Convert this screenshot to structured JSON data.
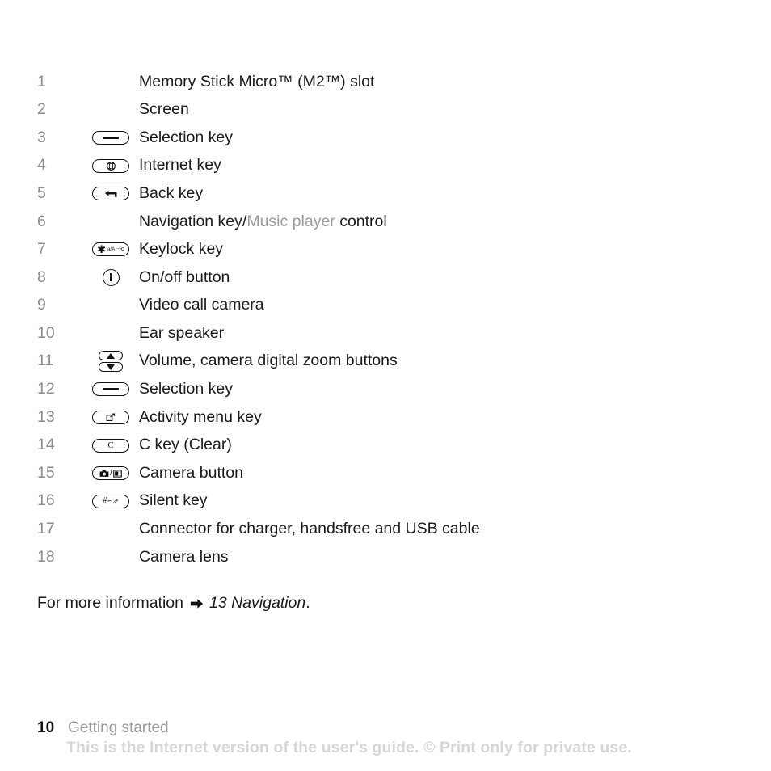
{
  "document": {
    "type": "user-guide-page",
    "page_number": "10",
    "section": "Getting started"
  },
  "legend": {
    "rows": [
      {
        "number": "1",
        "icon": "none",
        "label": "Memory Stick Micro™ (M2™) slot"
      },
      {
        "number": "2",
        "icon": "none",
        "label": "Screen"
      },
      {
        "number": "3",
        "icon": "selection-key",
        "label": "Selection key"
      },
      {
        "number": "4",
        "icon": "internet-key",
        "label": "Internet key"
      },
      {
        "number": "5",
        "icon": "back-key",
        "label": "Back key"
      },
      {
        "number": "6",
        "icon": "none",
        "label": "Navigation key/",
        "label_xref": "Music player",
        "label_after": " control"
      },
      {
        "number": "7",
        "icon": "keylock-key",
        "label": "Keylock key"
      },
      {
        "number": "8",
        "icon": "power-button",
        "label": "On/off button"
      },
      {
        "number": "9",
        "icon": "none",
        "label": "Video call camera"
      },
      {
        "number": "10",
        "icon": "none",
        "label": "Ear speaker"
      },
      {
        "number": "11",
        "icon": "volume-buttons",
        "label": "Volume, camera digital zoom buttons"
      },
      {
        "number": "12",
        "icon": "selection-key",
        "label": "Selection key"
      },
      {
        "number": "13",
        "icon": "activity-menu-key",
        "label": "Activity menu key"
      },
      {
        "number": "14",
        "icon": "c-key",
        "label": "C key (Clear)"
      },
      {
        "number": "15",
        "icon": "camera-button",
        "label": "Camera button"
      },
      {
        "number": "16",
        "icon": "silent-key",
        "label": "Silent key"
      },
      {
        "number": "17",
        "icon": "none",
        "label": "Connector for charger, handsfree and USB cable"
      },
      {
        "number": "18",
        "icon": "none",
        "label": "Camera lens"
      }
    ]
  },
  "more_info": {
    "prefix": "For more information",
    "arrow_icon": "right-arrow-icon",
    "reference": "13 Navigation",
    "suffix": "."
  },
  "footer": {
    "page_number": "10",
    "section_label": "Getting started",
    "watermark": "This is the Internet version of the user's guide. © Print only for private use."
  },
  "colors": {
    "number": "#8c8c8c",
    "text": "#1a1a1a",
    "xref": "#9a9a9a",
    "watermark": "#d6d6d6",
    "icon_stroke": "#111111",
    "background": "#ffffff"
  },
  "icon_labels": {
    "selection-key": "selection-key-icon",
    "internet-key": "globe-icon",
    "back-key": "back-arrow-icon",
    "keylock-key": "keylock-icon",
    "power-button": "power-icon",
    "volume-buttons": "volume-up-down-icon",
    "activity-menu-key": "activity-menu-icon",
    "c-key": "clear-key-icon",
    "camera-button": "camera-video-icon",
    "silent-key": "silent-hash-icon",
    "right-arrow-icon": "right-arrow-icon"
  }
}
